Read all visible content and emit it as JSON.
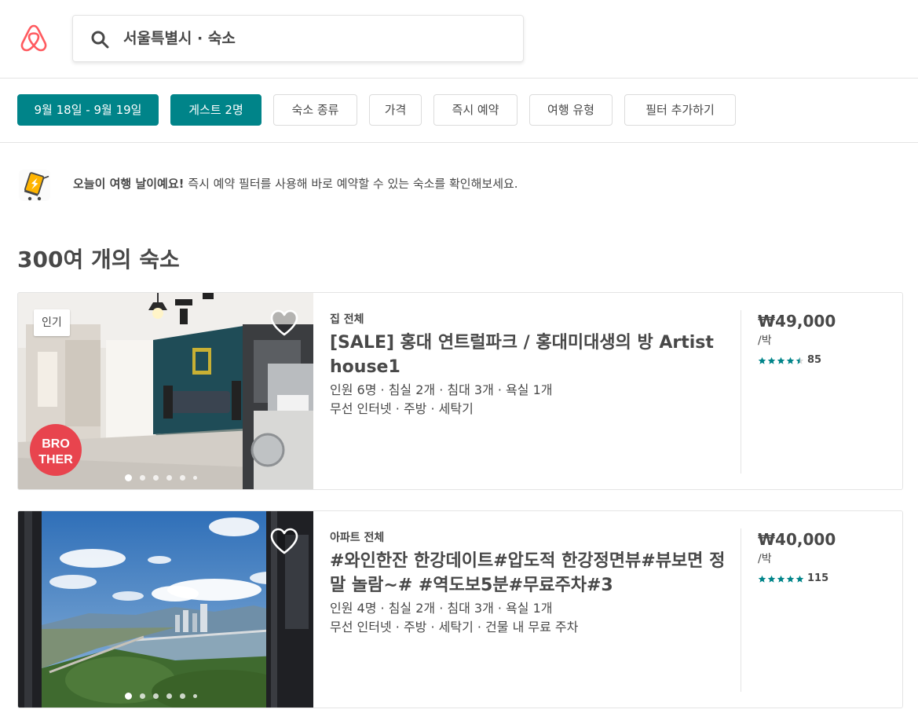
{
  "header": {
    "logo": "airbnb-logo",
    "search_value": "서울특별시 · 숙소"
  },
  "filters": [
    {
      "label": "9월 18일 - 9월 19일",
      "active": true
    },
    {
      "label": "게스트 2명",
      "active": true
    },
    {
      "label": "숙소 종류",
      "active": false
    },
    {
      "label": "가격",
      "active": false
    },
    {
      "label": "즉시 예약",
      "active": false
    },
    {
      "label": "여행 유형",
      "active": false
    },
    {
      "label": "필터 추가하기",
      "active": false
    }
  ],
  "banner": {
    "icon": "instant-book-cart-icon",
    "strong": "오늘이 여행 날이예요!",
    "text": "즉시 예약 필터를 사용해 바로 예약할 수 있는 숙소를 확인해보세요."
  },
  "results_title": "300여 개의 숙소",
  "listings": [
    {
      "badge": "인기",
      "logo_text": [
        "BRO",
        "THER"
      ],
      "room_type": "집 전체",
      "title": "[SALE] 홍대 연트럴파크 / 홍대미대생의 방 Artist house1",
      "details1": "인원 6명 · 침실 2개 · 침대 3개 · 욕실 1개",
      "details2": "무선 인터넷 · 주방 · 세탁기",
      "price": "₩49,000",
      "per": "/박",
      "rating": 4.5,
      "reviews": "85",
      "photo_count_dots": 6,
      "active_dot": 0
    },
    {
      "badge": "",
      "room_type": "아파트 전체",
      "title": "#와인한잔 한강데이트#압도적 한강정면뷰#뷰보면 정말 놀람~# #역도보5분#무료주차#3",
      "details1": "인원 4명 · 침실 2개 · 침대 3개 · 욕실 1개",
      "details2": "무선 인터넷 · 주방 · 세탁기 · 건물 내 무료 주차",
      "price": "₩40,000",
      "per": "/박",
      "rating": 5,
      "reviews": "115",
      "photo_count_dots": 6,
      "active_dot": 0
    }
  ],
  "colors": {
    "brand": "#FF5A5F",
    "teal": "#008489",
    "text": "#484848",
    "border": "#e4e4e4"
  }
}
